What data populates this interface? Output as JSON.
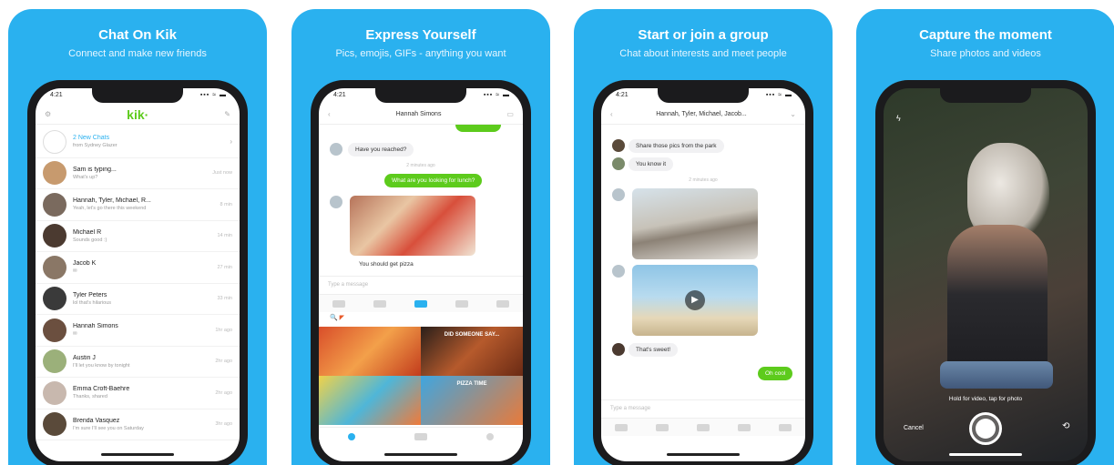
{
  "panels": [
    {
      "title": "Chat On Kik",
      "subtitle": "Connect and make new friends"
    },
    {
      "title": "Express Yourself",
      "subtitle": "Pics, emojis, GIFs - anything you want"
    },
    {
      "title": "Start or join a group",
      "subtitle": "Chat about interests and meet people"
    },
    {
      "title": "Capture the moment",
      "subtitle": "Share photos and videos"
    }
  ],
  "status_time": "4:21",
  "status_signal": "▪▪▪ ≈ ▬",
  "logo": "kik·",
  "chat_list": [
    {
      "name": "2 New Chats",
      "sub": "from Sydney Glazer",
      "time": ""
    },
    {
      "name": "Sam is typing...",
      "sub": "What's up?",
      "time": "Just now"
    },
    {
      "name": "Hannah, Tyler, Michael, R...",
      "sub": "Yeah, let's go there this weekend",
      "time": "8 min"
    },
    {
      "name": "Michael R",
      "sub": "Sounds good :)",
      "time": "14 min"
    },
    {
      "name": "Jacob K",
      "sub": "✉",
      "time": "27 min"
    },
    {
      "name": "Tyler Peters",
      "sub": "lol that's hilarious",
      "time": "33 min"
    },
    {
      "name": "Hannah Simons",
      "sub": "✉",
      "time": "1hr ago"
    },
    {
      "name": "Austin J",
      "sub": "I'll let you know by tonight",
      "time": "2hr ago"
    },
    {
      "name": "Emma Croft-Baehre",
      "sub": "Thanks, shared",
      "time": "2hr ago"
    },
    {
      "name": "Brenda Vasquez",
      "sub": "I'm sure I'll see you on Saturday",
      "time": "3hr ago"
    }
  ],
  "p2": {
    "header": "Hannah Simons",
    "msg1": "Have you reached?",
    "stamp": "2 minutes ago",
    "msg2": "What are you looking for lunch?",
    "caption": "You should get pizza",
    "input": "Type a message",
    "gif_text1": "DID SOMEONE SAY...",
    "gif_text2": "PIZZA TIME"
  },
  "p3": {
    "header": "Hannah, Tyler, Michael, Jacob...",
    "msg1": "Share those pics from the park",
    "msg2": "You know it",
    "stamp": "2 minutes ago",
    "msg3": "That's sweet!",
    "msg4": "Oh cool",
    "input": "Type a message"
  },
  "p4": {
    "hint": "Hold for video, tap for photo",
    "cancel": "Cancel"
  }
}
